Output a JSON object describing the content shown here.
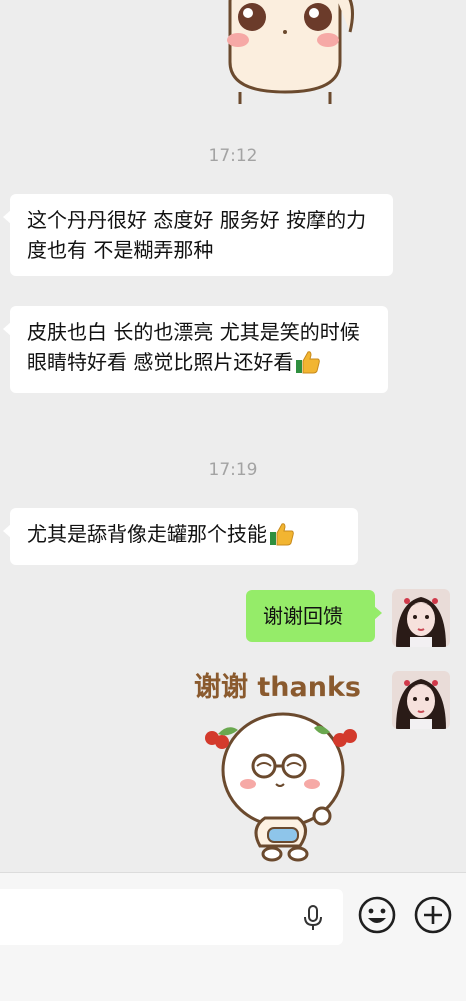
{
  "chat": {
    "timestamps": [
      "17:12",
      "17:19"
    ],
    "messages": [
      {
        "side": "received",
        "text": "这个丹丹很好 态度好 服务好 按摩的力度也有 不是糊弄那种"
      },
      {
        "side": "received",
        "text": "皮肤也白 长的也漂亮 尤其是笑的时候 眼睛特好看 感觉比照片还好看"
      },
      {
        "side": "received",
        "text": "尤其是舔背像走罐那个技能"
      },
      {
        "side": "sent",
        "text": "谢谢回馈"
      }
    ],
    "sticker_text": "谢谢 thanks"
  },
  "icons": {
    "thumbs_up": "thumbs-up-emoji",
    "mic": "microphone-icon",
    "emoji": "smiley-face-icon",
    "plus": "plus-circle-icon"
  },
  "colors": {
    "background": "#ededed",
    "received_bubble": "#ffffff",
    "sent_bubble": "#95ec69",
    "timestamp": "#a3a3a3",
    "sticker_text": "#8a5a2e"
  }
}
